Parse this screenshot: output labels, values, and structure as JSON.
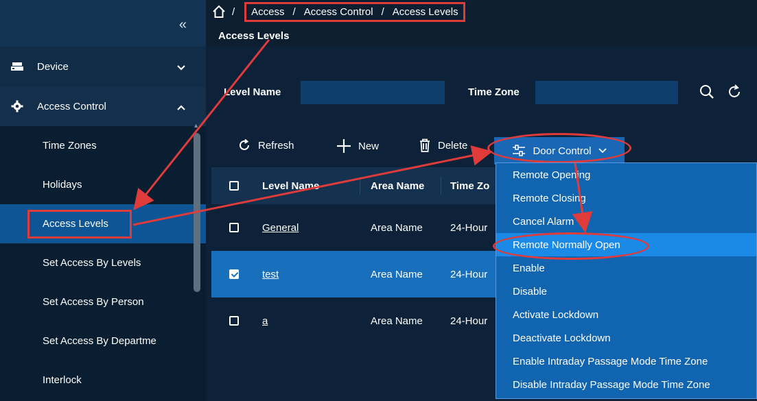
{
  "sidebar": {
    "collapse_icon": "double-chevron-left-icon",
    "groups": [
      {
        "label": "Device",
        "icon": "device-icon",
        "expanded": false
      },
      {
        "label": "Access Control",
        "icon": "gear-icon",
        "expanded": true
      }
    ],
    "items": [
      {
        "label": "Time Zones"
      },
      {
        "label": "Holidays"
      },
      {
        "label": "Access Levels"
      },
      {
        "label": "Set Access By Levels"
      },
      {
        "label": "Set Access By Person"
      },
      {
        "label": "Set Access By Departme"
      },
      {
        "label": "Interlock"
      }
    ]
  },
  "breadcrumb": {
    "home_sep": "/",
    "items": [
      "Access",
      "Access Control",
      "Access Levels"
    ],
    "sep": "/"
  },
  "page": {
    "title": "Access Levels"
  },
  "filter": {
    "level_name_label": "Level Name",
    "time_zone_label": "Time Zone"
  },
  "toolbar": {
    "refresh": "Refresh",
    "new": "New",
    "delete": "Delete",
    "door_control": "Door Control"
  },
  "table": {
    "headers": [
      "Level Name",
      "Area Name",
      "Time Zo"
    ],
    "rows": [
      {
        "name": "General",
        "area": "Area Name",
        "tz": "24-Hour",
        "checked": false
      },
      {
        "name": "test",
        "area": "Area Name",
        "tz": "24-Hour",
        "checked": true
      },
      {
        "name": "a",
        "area": "Area Name",
        "tz": "24-Hour",
        "checked": false
      }
    ]
  },
  "door_menu": {
    "items": [
      "Remote Opening",
      "Remote Closing",
      "Cancel Alarm",
      "Remote Normally Open",
      "Enable",
      "Disable",
      "Activate Lockdown",
      "Deactivate Lockdown",
      "Enable Intraday Passage Mode Time Zone",
      "Disable Intraday Passage Mode Time Zone"
    ],
    "highlighted": "Remote Normally Open"
  },
  "colors": {
    "accent": "#1a67b6",
    "annotation": "#e03b3b",
    "active_item": "#0d5595"
  }
}
